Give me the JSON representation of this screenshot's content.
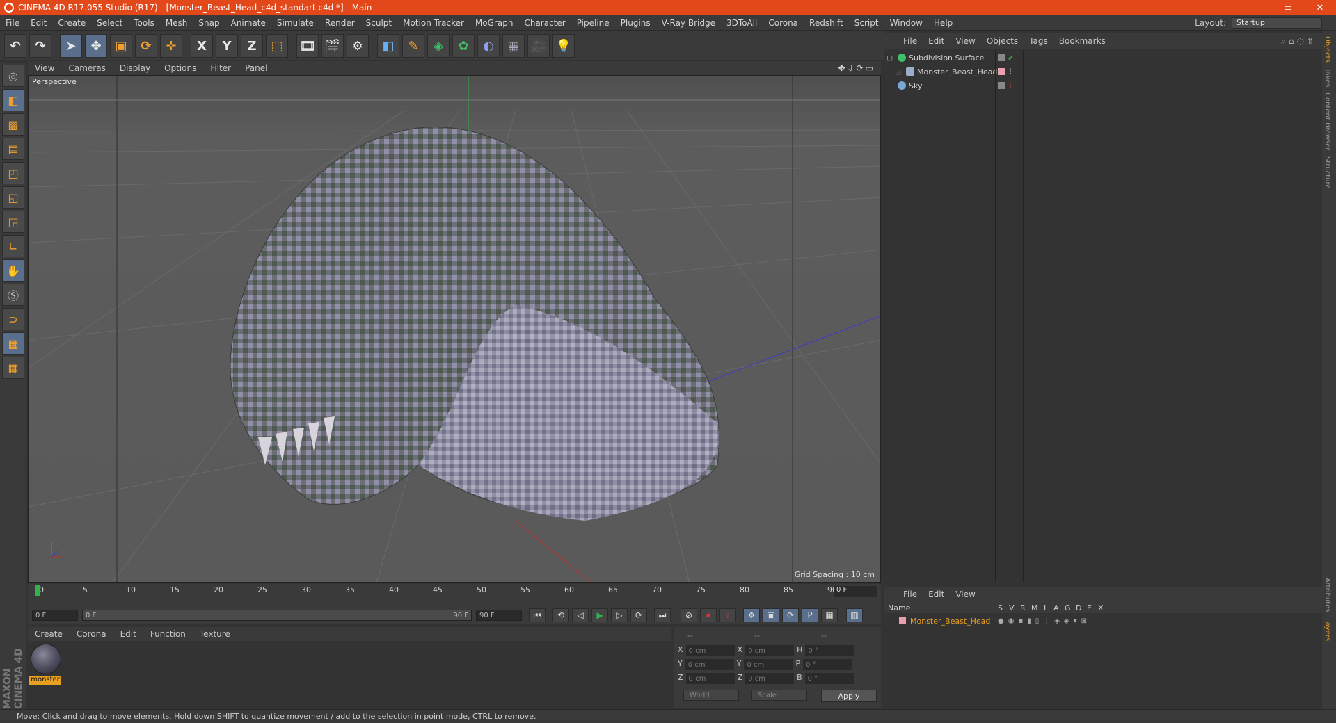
{
  "window": {
    "title": "CINEMA 4D R17.055 Studio (R17) - [Monster_Beast_Head_c4d_standart.c4d *] - Main",
    "controls": [
      "–",
      "▭",
      "✕"
    ]
  },
  "menubar": {
    "items": [
      "File",
      "Edit",
      "Create",
      "Select",
      "Tools",
      "Mesh",
      "Snap",
      "Animate",
      "Simulate",
      "Render",
      "Sculpt",
      "Motion Tracker",
      "MoGraph",
      "Character",
      "Pipeline",
      "Plugins",
      "V-Ray Bridge",
      "3DToAll",
      "Corona",
      "Redshift",
      "Script",
      "Window",
      "Help"
    ],
    "layout_label": "Layout:",
    "layout_value": "Startup"
  },
  "toolbar": {
    "icons": [
      "undo-icon",
      "redo-icon",
      "select-icon",
      "move-icon",
      "scale-icon",
      "rotate-icon",
      "move-axis-icon",
      "x-axis-icon",
      "y-axis-icon",
      "z-axis-icon",
      "coordinate-system-icon",
      "render-view-icon",
      "render-picture-viewer-icon",
      "render-settings-icon",
      "cube-icon",
      "pen-icon",
      "subdivision-icon",
      "array-icon",
      "deformer-icon",
      "floor-icon",
      "camera-icon",
      "light-icon"
    ],
    "axis_labels": [
      "X",
      "Y",
      "Z"
    ]
  },
  "left_tools": {
    "icons": [
      "make-editable-icon",
      "model-mode-icon",
      "texture-mode-icon",
      "workplane-icon",
      "points-mode-icon",
      "edges-mode-icon",
      "polygons-mode-icon",
      "axis-mode-icon",
      "tweak-mode-icon",
      "snap-icon",
      "magnet-icon",
      "grid-lock-icon",
      "enable-grid-icon"
    ]
  },
  "branding": {
    "logo": "MAXON CINEMA 4D"
  },
  "viewport": {
    "menu": [
      "View",
      "Cameras",
      "Display",
      "Options",
      "Filter",
      "Panel"
    ],
    "camera_label": "Perspective",
    "grid_spacing": "Grid Spacing : 10 cm"
  },
  "timeline": {
    "ticks": [
      "0",
      "5",
      "10",
      "15",
      "20",
      "25",
      "30",
      "35",
      "40",
      "45",
      "50",
      "55",
      "60",
      "65",
      "70",
      "75",
      "80",
      "85",
      "90"
    ],
    "current_frame": "0 F",
    "start_field": "0 F",
    "range_start": "0 F",
    "range_end": "90 F",
    "end_field": "90 F"
  },
  "material_manager": {
    "menu": [
      "Create",
      "Corona",
      "Edit",
      "Function",
      "Texture"
    ],
    "materials": [
      {
        "name": "monster"
      }
    ]
  },
  "coordinates": {
    "header": [
      "--",
      "--",
      "--"
    ],
    "rows": [
      {
        "axis": "X",
        "pos": "0 cm",
        "axis2": "X",
        "size": "0 cm",
        "rot_label": "H",
        "rot": "0 °"
      },
      {
        "axis": "Y",
        "pos": "0 cm",
        "axis2": "Y",
        "size": "0 cm",
        "rot_label": "P",
        "rot": "0 °"
      },
      {
        "axis": "Z",
        "pos": "0 cm",
        "axis2": "Z",
        "size": "0 cm",
        "rot_label": "B",
        "rot": "0 °"
      }
    ],
    "space": "World",
    "mode": "Scale",
    "apply": "Apply"
  },
  "object_manager": {
    "menu": [
      "File",
      "Edit",
      "View",
      "Objects",
      "Tags",
      "Bookmarks"
    ],
    "objects": [
      {
        "name": "Subdivision Surface",
        "icon_color": "#3fbf6a"
      },
      {
        "name": "Monster_Beast_Head",
        "icon_color": "#9aaec8"
      },
      {
        "name": "Sky",
        "icon_color": "#7aa6d8"
      }
    ]
  },
  "right_tabs": [
    "Objects",
    "Takes",
    "Content Browser",
    "Structure",
    "Attributes",
    "Layers"
  ],
  "layer_manager": {
    "menu": [
      "File",
      "Edit",
      "View"
    ],
    "columns": [
      "Name",
      "S",
      "V",
      "R",
      "M",
      "L",
      "A",
      "G",
      "D",
      "E",
      "X"
    ],
    "layers": [
      {
        "name": "Monster_Beast_Head",
        "color": "#e8a020"
      }
    ]
  },
  "status": {
    "text": "Move: Click and drag to move elements. Hold down SHIFT to quantize movement / add to the selection in point mode, CTRL to remove."
  },
  "colors": {
    "accent": "#e2481a",
    "selection": "#e8a020"
  }
}
